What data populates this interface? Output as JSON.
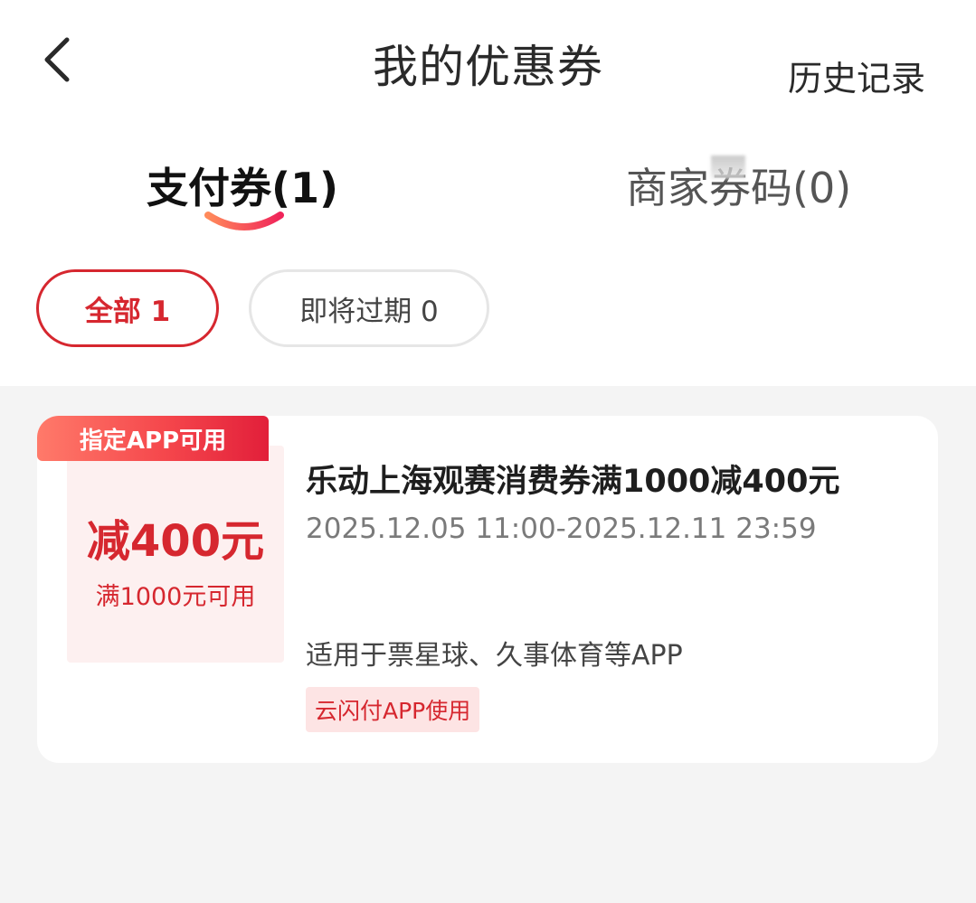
{
  "header": {
    "title": "我的优惠券",
    "history_label": "历史记录"
  },
  "tabs": [
    {
      "label": "支付券(1)",
      "active": true
    },
    {
      "label": "商家券码(0)",
      "active": false
    }
  ],
  "filters": [
    {
      "label": "全部 1",
      "active": true
    },
    {
      "label": "即将过期 0",
      "active": false
    }
  ],
  "colors": {
    "accent": "#d6272f",
    "tab_underline_start": "#ff8a5b",
    "tab_underline_end": "#f0245a",
    "list_background": "#f4f4f4",
    "amount_box_bg": "#fdf0f0"
  },
  "coupons": [
    {
      "badge": "指定APP可用",
      "amount": "减400元",
      "threshold": "满1000元可用",
      "title": "乐动上海观赛消费券满1000减400元",
      "validity": "2025.12.05 11:00-2025.12.11 23:59",
      "scope": "适用于票星球、久事体育等APP",
      "tag": "云闪付APP使用"
    }
  ],
  "icons": {
    "back": "chevron-left-icon"
  }
}
